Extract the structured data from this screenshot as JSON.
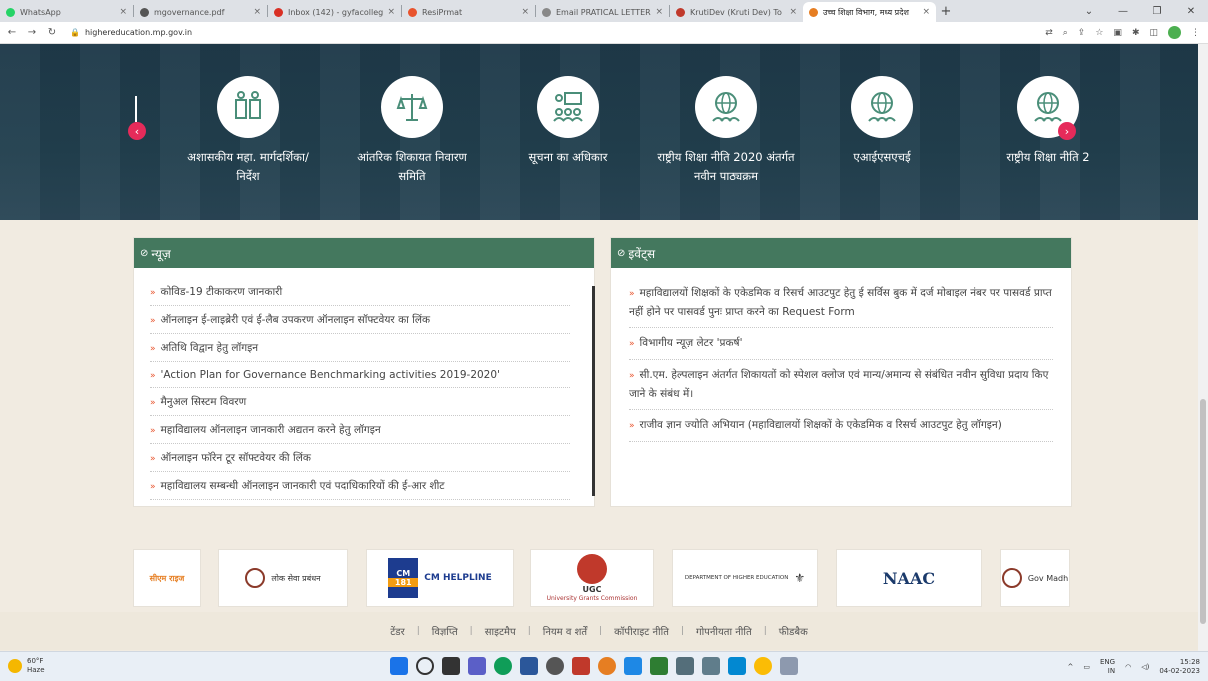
{
  "browser": {
    "tabs": [
      {
        "title": "WhatsApp",
        "color": "#25d366"
      },
      {
        "title": "mgovernance.pdf",
        "color": "#555555"
      },
      {
        "title": "Inbox (142) - gyfacollegemorena",
        "color": "#d93025"
      },
      {
        "title": "ResiPrmat",
        "color": "#e8532d"
      },
      {
        "title": "Email PRATICAL LETTER",
        "color": "#888888"
      },
      {
        "title": "KrutiDev (Kruti Dev) To Unicode",
        "color": "#c0392b"
      },
      {
        "title": "उच्च शिक्षा विभाग, मध्य प्रदेश",
        "color": "#e67e22"
      }
    ],
    "new_tab": "+",
    "url": "highereducation.mp.gov.in"
  },
  "quick_links": [
    {
      "label": "अशासकीय महा. मार्गदर्शिका/ निर्देश",
      "icon": "documents-icon"
    },
    {
      "label": "आंतरिक शिकायत निवारण समिति",
      "icon": "justice-scale-icon"
    },
    {
      "label": "सूचना का अधिकार",
      "icon": "people-board-icon"
    },
    {
      "label": "राष्ट्रीय शिक्षा नीति 2020 अंतर्गत नवीन पाठ्यक्रम",
      "icon": "globe-group-icon"
    },
    {
      "label": "एआईएसएचई",
      "icon": "globe-group-icon"
    },
    {
      "label": "राष्ट्रीय शिक्षा नीति 2",
      "icon": "globe-group-icon"
    }
  ],
  "news": {
    "title": "न्यूज़",
    "items": [
      "कोविड-19 टीकाकरण जानकारी",
      "ऑनलाइन ई-लाइब्रेरी एवं ई-लैब उपकरण ऑनलाइन सॉफ्टवेयर का लिंक",
      "अतिथि विद्वान हेतु लॉगइन",
      "'Action Plan for Governance Benchmarking activities 2019-2020'",
      "मैनुअल सिस्टम विवरण",
      "महाविद्यालय ऑनलाइन जानकारी अद्यतन करने हेतु लॉगइन",
      "ऑनलाइन फॉरेन टूर सॉफ्टवेयर की लिंक",
      "महाविद्यालय सम्बन्धी ऑनलाइन जानकारी एवं पदाधिकारियों की ई-आर शीट"
    ]
  },
  "events": {
    "title": "इवेंट्स",
    "items": [
      "महाविद्यालयों शिक्षकों के एकेडमिक व रिसर्च आउटपुट हेतु ई सर्विस बुक में दर्ज मोबाइल नंबर पर पासवर्ड प्राप्त नहीं होने पर पासवर्ड पुनः प्राप्त करने का Request Form",
      "विभागीय न्यूज़ लेटर 'प्रकर्ष'",
      "सी.एम. हेल्पलाइन अंतर्गत शिकायतों को स्पेशल क्लोज एवं मान्य/अमान्य से संबंधित नवीन सुविधा प्रदाय किए जाने के संबंध में।",
      "राजीव ज्ञान ज्योति अभियान (महाविद्यालयों शिक्षकों के एकेडमिक व रिसर्च आउटपुट हेतु लॉगइन)"
    ]
  },
  "partners": {
    "logo1": "सीएम राइज",
    "logo2": "लोक सेवा प्रबंधन",
    "cm_helpline": "CM HELPLINE",
    "cm_top": "CM",
    "cm_num": "181",
    "ugc": "UGC",
    "ugc_sub": "University Grants Commission",
    "dhe": "DEPARTMENT OF HIGHER EDUCATION",
    "naac": "NAAC",
    "govt": "Gov Madh"
  },
  "footer": {
    "links": [
      "टेंडर",
      "विज्ञप्ति",
      "साइटमैप",
      "नियम व शर्तें",
      "कॉपीराइट नीति",
      "गोपनीयता नीति",
      "फीडबैक"
    ]
  },
  "taskbar": {
    "temp": "60°F",
    "weather": "Haze",
    "lang": "ENG",
    "lang_sub": "IN",
    "time": "15:28",
    "date": "04-02-2023"
  }
}
